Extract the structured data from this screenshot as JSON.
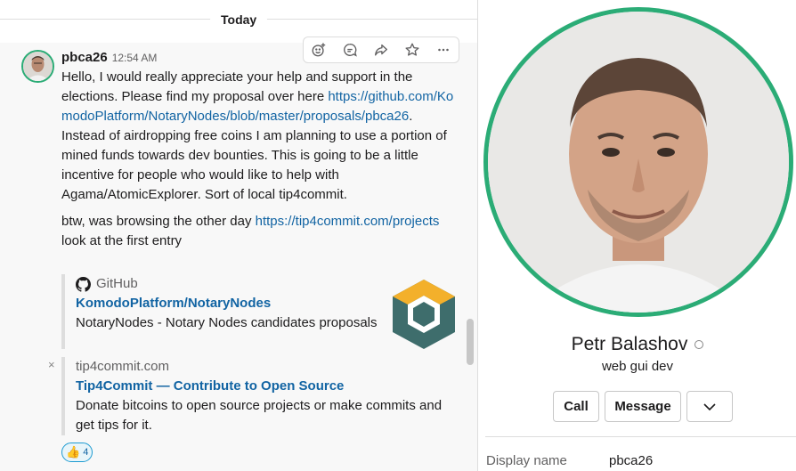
{
  "conversation": {
    "date_divider": "Today",
    "message": {
      "author": "pbca26",
      "time": "12:54 AM",
      "paragraph_1_pre": "Hello, I would really appreciate your help and support in the elections. Please find my proposal over here ",
      "link_1": "https://github.com/KomodoPlatform/NotaryNodes/blob/master/proposals/pbca26",
      "paragraph_1_post": ".",
      "paragraph_2": "Instead of airdropping free coins I am planning to use a portion of mined funds towards dev bounties. This is going to be a little incentive for people who would like to help with Agama/AtomicExplorer. Sort of local tip4commit.",
      "paragraph_3_pre": "btw, was browsing the other day ",
      "link_2": "https://tip4commit.com/projects",
      "paragraph_3_post": " look at the first entry"
    },
    "attachments": [
      {
        "source": "GitHub",
        "title": "KomodoPlatform/NotaryNodes",
        "text": "NotaryNodes - Notary Nodes candidates proposals"
      },
      {
        "source": "tip4commit.com",
        "title": "Tip4Commit —  Contribute to Open Source",
        "text": "Donate bitcoins to open source projects or make commits and get tips for it.",
        "close": "×"
      }
    ],
    "reaction": {
      "emoji": "👍",
      "count": "4"
    },
    "toolbar_icons": [
      "add-reaction-icon",
      "reply-thread-icon",
      "share-message-icon",
      "star-icon",
      "more-actions-icon"
    ]
  },
  "profile": {
    "name": "Petr Balashov",
    "title": "web gui dev",
    "actions": {
      "call": "Call",
      "message": "Message"
    },
    "fields": [
      {
        "label": "Display name",
        "value": "pbca26"
      }
    ]
  },
  "colors": {
    "presence_green": "#2bac76",
    "link_blue": "#1264a3",
    "reaction_border": "#1d9bd1"
  }
}
